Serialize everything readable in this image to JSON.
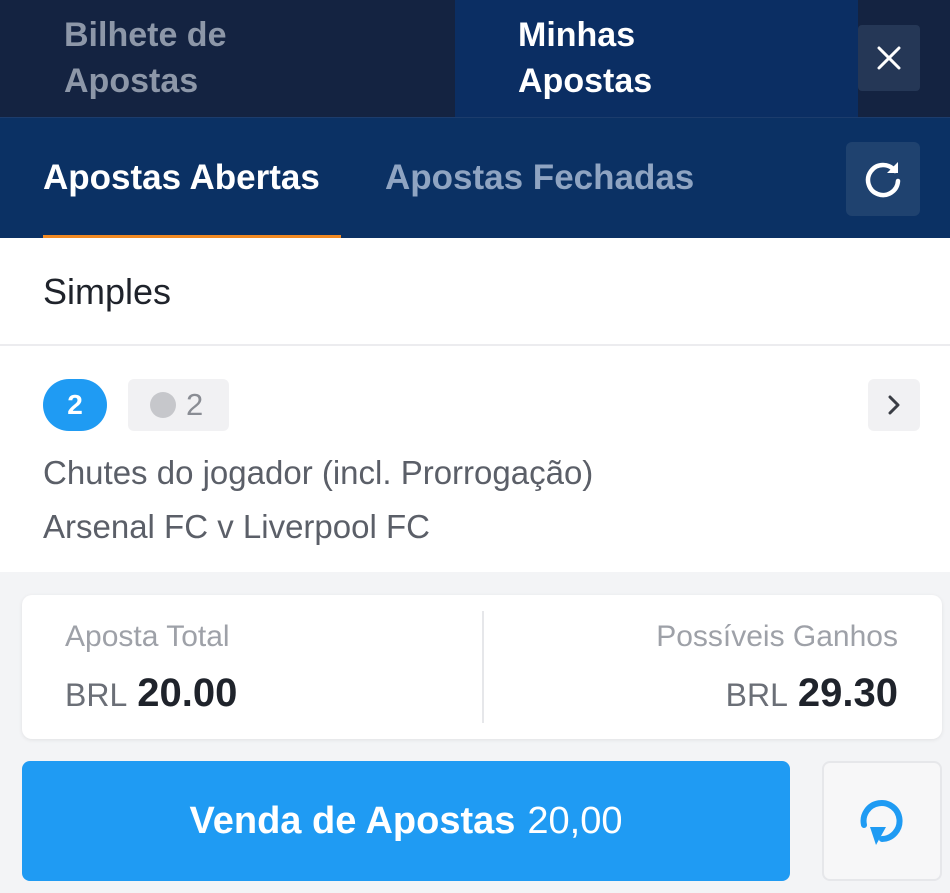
{
  "top_tabs": {
    "betslip": "Bilhete de Apostas",
    "my_bets": "Minhas Apostas",
    "close_icon": "close-icon"
  },
  "sub_tabs": {
    "open_bets": "Apostas Abertas",
    "closed_bets": "Apostas Fechadas",
    "refresh_icon": "refresh-icon"
  },
  "section": {
    "title": "Simples"
  },
  "bet": {
    "count": "2",
    "live_count": "2",
    "market": "Chutes do jogador (incl. Prorrogação)",
    "event": "Arsenal FC v Liverpool FC"
  },
  "totals": {
    "stake_label": "Aposta Total",
    "stake_currency": "BRL",
    "stake_amount": "20.00",
    "winnings_label": "Possíveis Ganhos",
    "winnings_currency": "BRL",
    "winnings_amount": "29.30"
  },
  "cashout": {
    "label": "Venda de Apostas",
    "amount": "20,00"
  },
  "colors": {
    "header_dark": "#142341",
    "header_blue": "#0b3164",
    "accent_orange": "#f28a22",
    "primary_blue": "#1f9bf3"
  }
}
